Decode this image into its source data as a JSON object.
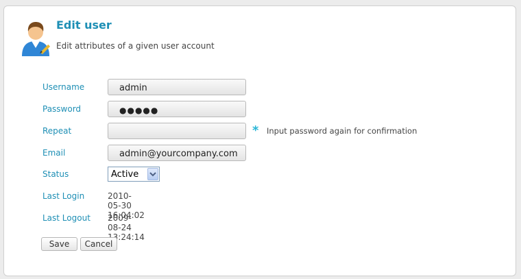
{
  "header": {
    "title": "Edit user",
    "subtitle": "Edit attributes of a given user account",
    "icon": "user-edit-icon"
  },
  "form": {
    "username": {
      "label": "Username",
      "value": "admin"
    },
    "password": {
      "label": "Password",
      "value": "●●●●●"
    },
    "repeat": {
      "label": "Repeat",
      "value": "",
      "hint_marker": "*",
      "hint": "Input password again for confirmation"
    },
    "email": {
      "label": "Email",
      "value": "admin@yourcompany.com"
    },
    "status": {
      "label": "Status",
      "selected": "Active"
    },
    "last_login": {
      "label": "Last Login",
      "value": "2010-05-30 16:04:02"
    },
    "last_logout": {
      "label": "Last Logout",
      "value": "2009-08-24 13:24:14"
    }
  },
  "actions": {
    "save_label": "Save",
    "cancel_label": "Cancel"
  },
  "colors": {
    "accent": "#1e8fb5",
    "hint_marker": "#29b6d6"
  }
}
